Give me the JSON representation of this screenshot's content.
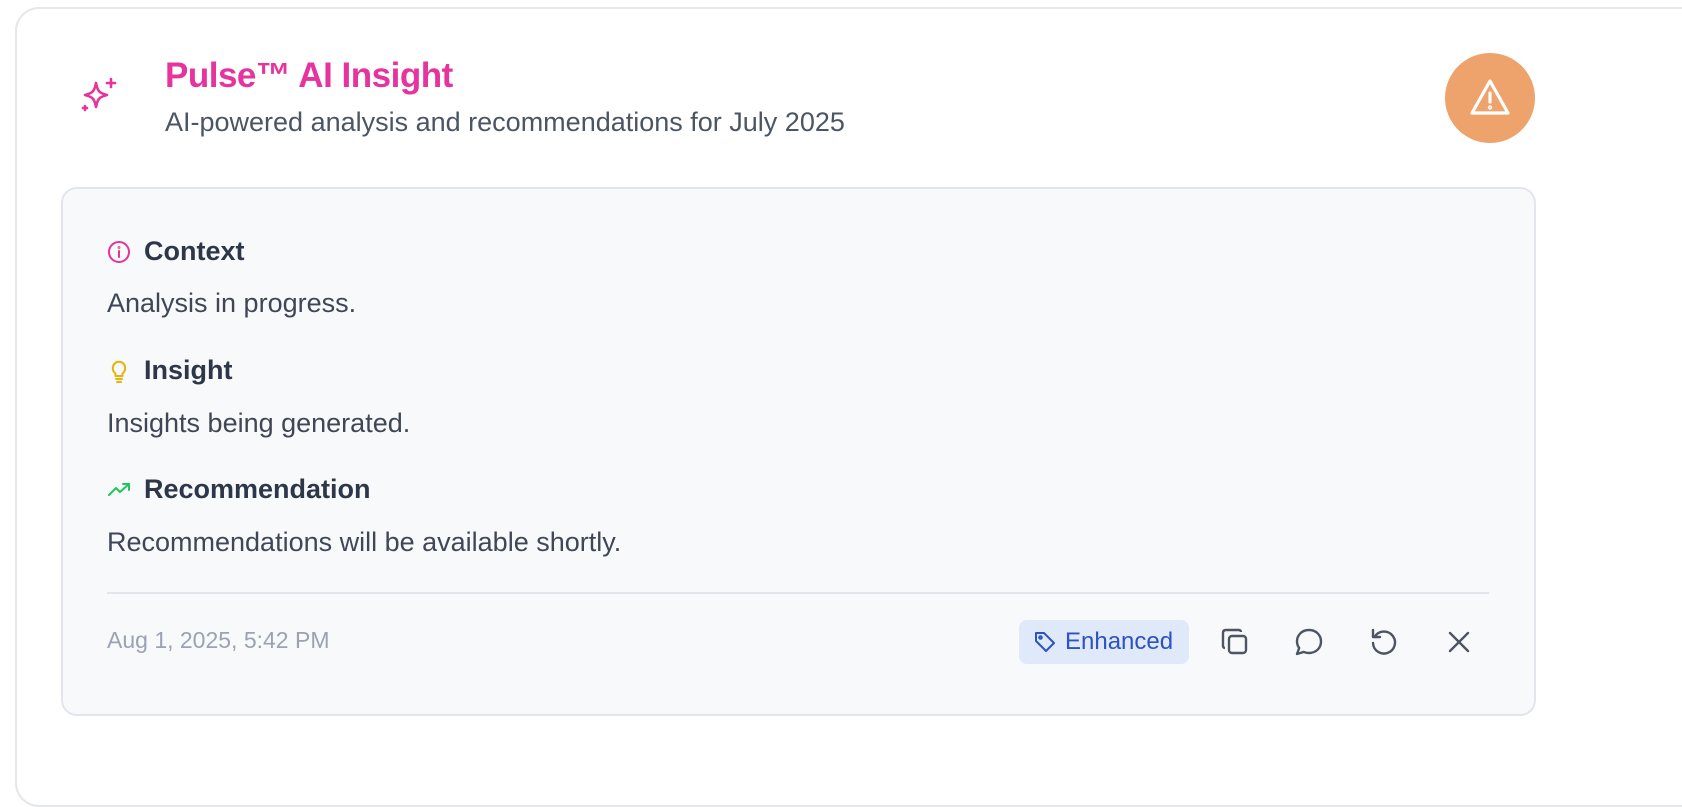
{
  "header": {
    "title": "Pulse™ AI Insight",
    "subtitle": "AI-powered analysis and recommendations for July 2025",
    "title_icon": "sparkles-icon",
    "alert_icon": "alert-triangle-icon"
  },
  "sections": [
    {
      "label": "Context",
      "text": "Analysis in progress.",
      "icon": "info-circle-icon"
    },
    {
      "label": "Insight",
      "text": "Insights being generated.",
      "icon": "lightbulb-icon"
    },
    {
      "label": "Recommendation",
      "text": "Recommendations will be available shortly.",
      "icon": "trending-up-icon"
    }
  ],
  "footer": {
    "timestamp": "Aug 1, 2025, 5:42 PM",
    "badge_label": "Enhanced",
    "badge_icon": "tag-icon",
    "actions": [
      "copy-icon",
      "comment-icon",
      "refresh-icon",
      "close-icon"
    ]
  },
  "colors": {
    "accent_pink": "#e6339d",
    "alert_orange": "#eea26c",
    "insight_yellow": "#eab308",
    "recommendation_green": "#22c55e",
    "badge_bg": "#dfe9f9",
    "badge_text": "#2b53c2"
  }
}
